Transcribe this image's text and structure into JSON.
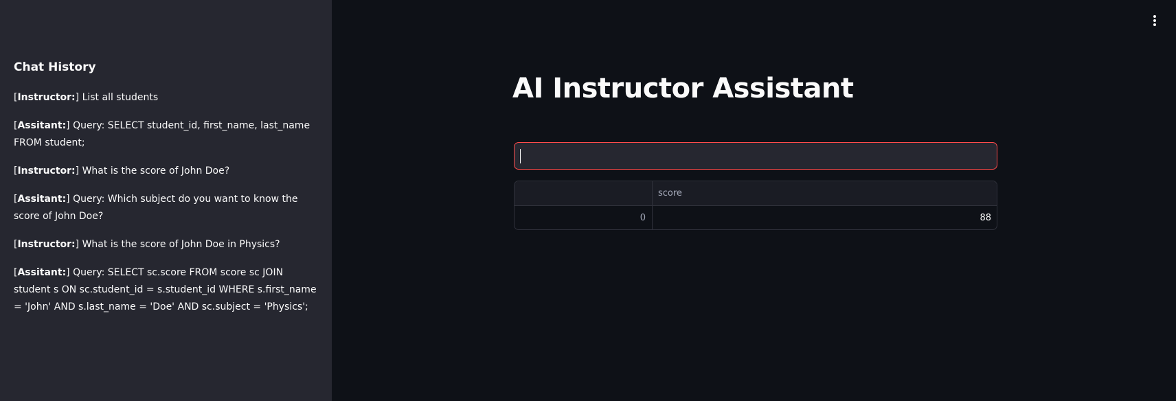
{
  "sidebar": {
    "title": "Chat History",
    "messages": [
      {
        "role": "Instructor:",
        "text": "List all students"
      },
      {
        "role": "Assitant:",
        "text": "Query: SELECT student_id, first_name, last_name FROM student;"
      },
      {
        "role": "Instructor:",
        "text": "What is the score of John Doe?"
      },
      {
        "role": "Assitant:",
        "text": "Query: Which subject do you want to know the score of John Doe?"
      },
      {
        "role": "Instructor:",
        "text": "What is the score of John Doe in Physics?"
      },
      {
        "role": "Assitant:",
        "text": "Query: SELECT sc.score FROM score sc JOIN student s ON sc.student_id = s.student_id WHERE s.first_name = 'John' AND s.last_name = 'Doe' AND sc.subject = 'Physics';"
      }
    ]
  },
  "main": {
    "title": "AI Instructor Assistant",
    "input_value": "",
    "table": {
      "columns": [
        "",
        "score"
      ],
      "rows": [
        {
          "index": "0",
          "score": "88"
        }
      ]
    }
  },
  "icons": {
    "menu": "more-vertical-icon"
  },
  "colors": {
    "sidebar_bg": "#262730",
    "main_bg": "#0e1117",
    "accent": "#ff4b4b"
  }
}
